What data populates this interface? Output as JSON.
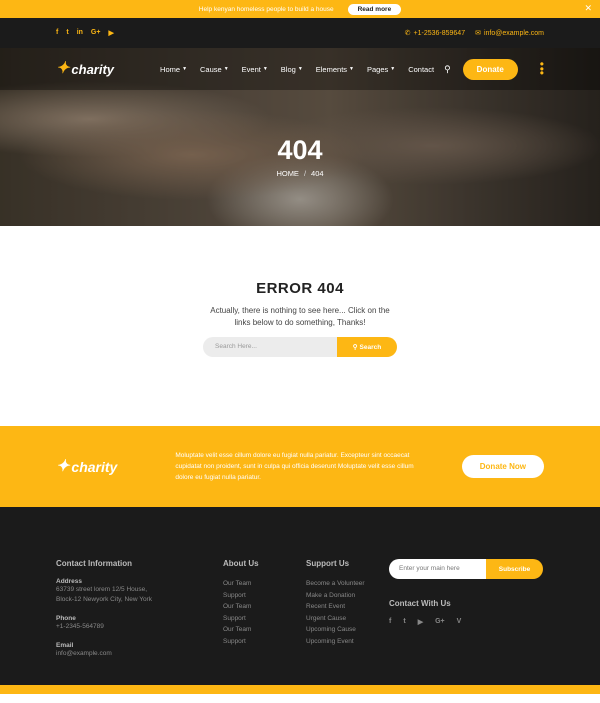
{
  "announce": {
    "text": "Help kenyan homeless people to build a house",
    "button": "Read more",
    "close": "✕"
  },
  "topbar": {
    "socials": [
      {
        "icon": "facebook-icon",
        "glyph": "f"
      },
      {
        "icon": "twitter-icon",
        "glyph": "t"
      },
      {
        "icon": "linkedin-icon",
        "glyph": "in"
      },
      {
        "icon": "google-plus-icon",
        "glyph": "G+"
      },
      {
        "icon": "youtube-icon",
        "glyph": "▶"
      }
    ],
    "phone": "+1-2536-859647",
    "email": "info@example.com"
  },
  "brand": {
    "name": "charity"
  },
  "nav": {
    "items": [
      {
        "label": "Home",
        "dropdown": true
      },
      {
        "label": "Cause",
        "dropdown": true
      },
      {
        "label": "Event",
        "dropdown": true
      },
      {
        "label": "Blog",
        "dropdown": true
      },
      {
        "label": "Elements",
        "dropdown": true
      },
      {
        "label": "Pages",
        "dropdown": true
      },
      {
        "label": "Contact",
        "dropdown": false
      }
    ],
    "donate": "Donate"
  },
  "hero": {
    "title": "404",
    "crumb_home": "HOME",
    "crumb_sep": "/",
    "crumb_current": "404"
  },
  "error": {
    "heading": "ERROR 404",
    "message": "Actually, there is nothing to see here... Click on the links below to do something, Thanks!",
    "search_placeholder": "Search Here...",
    "search_button": "Search"
  },
  "cta": {
    "text": "Moluptate velit esse cillum dolore eu fugiat nulla pariatur. Excepteur sint occaecat cupidatat non proident, sunt in culpa qui officia deserunt Moluptate velit esse cillum dolore eu fugiat nulla pariatur.",
    "button": "Donate Now"
  },
  "footer": {
    "contact": {
      "title": "Contact Information",
      "address_label": "Address",
      "address": "63739 street lorem 12/5 House, Block-12 Newyork City, New York",
      "phone_label": "Phone",
      "phone": "+1-2345-564789",
      "email_label": "Email",
      "email": "info@example.com"
    },
    "about": {
      "title": "About Us",
      "links": [
        "Our Team",
        "Support",
        "Our Team",
        "Support",
        "Our Team",
        "Support"
      ]
    },
    "support": {
      "title": "Support Us",
      "links": [
        "Become a Volunteer",
        "Make a Donation",
        "Recent Event",
        "Urgent Cause",
        "Upcoming Cause",
        "Upcoming Event"
      ]
    },
    "subscribe": {
      "placeholder": "Enter your main here",
      "button": "Subscribe"
    },
    "connect": {
      "title": "Contact With Us",
      "socials": [
        {
          "icon": "facebook-icon",
          "glyph": "f"
        },
        {
          "icon": "twitter-icon",
          "glyph": "t"
        },
        {
          "icon": "youtube-icon",
          "glyph": "▶"
        },
        {
          "icon": "google-plus-icon",
          "glyph": "G+"
        },
        {
          "icon": "vimeo-icon",
          "glyph": "V"
        }
      ]
    }
  },
  "colors": {
    "accent": "#fdb714",
    "dark": "#1b1b1b"
  }
}
